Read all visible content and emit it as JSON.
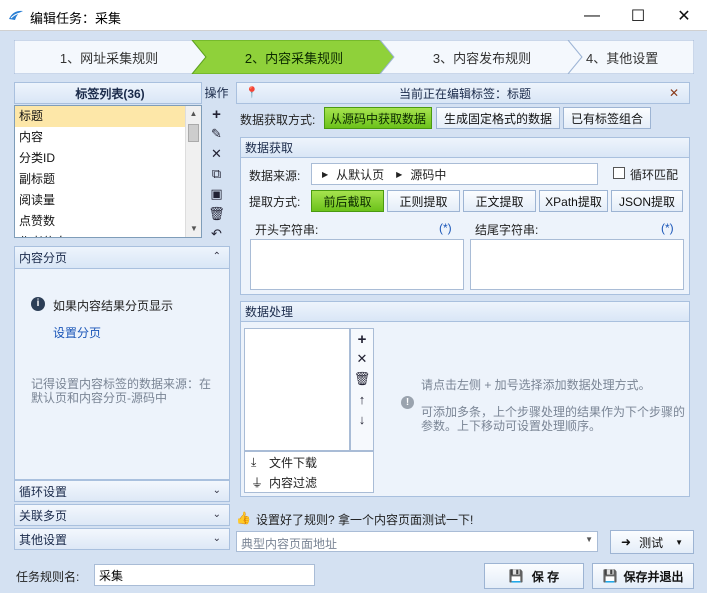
{
  "window": {
    "title": "编辑任务：采集",
    "minimize": "—",
    "maximize": "☐",
    "close": "✕"
  },
  "steps": [
    "1、网址采集规则",
    "2、内容采集规则",
    "3、内容发布规则",
    "4、其他设置"
  ],
  "tags": {
    "header": "标签列表(36)",
    "ops_label": "操作",
    "items": [
      "标题",
      "内容",
      "分类ID",
      "副标题",
      "阅读量",
      "点赞数",
      "作者信息"
    ],
    "selected": 0
  },
  "pagination": {
    "header": "内容分页",
    "info": "如果内容结果分页显示",
    "link": "设置分页",
    "note": "记得设置内容标签的数据来源：在默认页和内容分页-源码中"
  },
  "collapsed": [
    "循环设置",
    "关联多页",
    "其他设置"
  ],
  "editing": {
    "text": "当前正在编辑标签：标题"
  },
  "acquire": {
    "label": "数据获取方式:",
    "options": [
      "从源码中获取数据",
      "生成固定格式的数据",
      "已有标签组合"
    ],
    "active": 0
  },
  "fetch": {
    "header": "数据获取",
    "source_label": "数据来源:",
    "source_path": [
      "从默认页",
      "源码中"
    ],
    "loop_label": "循环匹配",
    "method_label": "提取方式:",
    "methods": [
      "前后截取",
      "正则提取",
      "正文提取",
      "XPath提取",
      "JSON提取"
    ],
    "active_method": 0,
    "start_label": "开头字符串:",
    "end_label": "结尾字符串:",
    "wildcard": "(*)"
  },
  "processing": {
    "header": "数据处理",
    "items": [
      "文件下载",
      "内容过滤"
    ],
    "hint1": "请点击左侧 + 加号选择添加数据处理方式。",
    "hint2": "可添加多条，上个步骤处理的结果作为下个步骤的参数。上下移动可设置处理顺序。"
  },
  "test": {
    "prompt": "设置好了规则? 拿一个内容页面测试一下!",
    "placeholder": "典型内容页面地址",
    "button": "测试"
  },
  "footer": {
    "name_label": "任务规则名:",
    "name_value": "采集",
    "save": "保 存",
    "save_exit": "保存并退出"
  }
}
